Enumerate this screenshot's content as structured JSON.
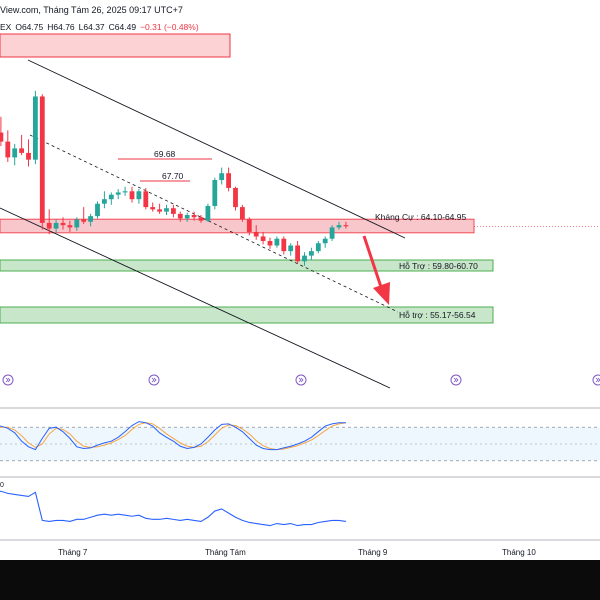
{
  "header": {
    "source": "View.com, Tháng Tám 26, 2025 09:17 UTC+7",
    "symbol_suffix": "EX",
    "open": "O64.75",
    "high": "H64.76",
    "low": "L64.37",
    "close": "C64.49",
    "change": "−0.31 (−0.48%)"
  },
  "levels": {
    "resistance": "Kháng Cự : 64.10-64.95",
    "support1": "Hỗ Trợ : 59.80-60.70",
    "support2": "Hỗ trợ : 55.17-56.54",
    "peak1": "69.68",
    "peak2": "67.70"
  },
  "stoch_label": "",
  "rsi_value": "0",
  "months": [
    "Tháng 7",
    "Tháng Tám",
    "Tháng 9",
    "Tháng 10"
  ],
  "colors": {
    "bull": "#26a69a",
    "bear": "#f23645",
    "resistance_fill": "#f8c2c6",
    "support_fill": "#c8e6c9",
    "line_blue": "#2962ff",
    "line_orange": "#f7a541"
  },
  "chart_data": {
    "type": "candlestick",
    "candles": [
      [
        70.5,
        73.5,
        69.8,
        72.8
      ],
      [
        72.8,
        74.2,
        71.6,
        72.0
      ],
      [
        72.0,
        73.0,
        70.2,
        70.6
      ],
      [
        70.6,
        71.8,
        69.9,
        71.4
      ],
      [
        71.4,
        72.6,
        70.8,
        71.0
      ],
      [
        71.0,
        72.2,
        69.8,
        70.4
      ],
      [
        70.4,
        76.5,
        70.0,
        76.0
      ],
      [
        76.0,
        76.2,
        64.2,
        64.8
      ],
      [
        64.8,
        66.0,
        63.8,
        64.3
      ],
      [
        64.3,
        65.1,
        63.9,
        64.8
      ],
      [
        64.8,
        65.3,
        64.2,
        64.6
      ],
      [
        64.6,
        65.0,
        64.0,
        64.4
      ],
      [
        64.4,
        65.3,
        64.1,
        65.1
      ],
      [
        65.1,
        66.2,
        64.7,
        64.9
      ],
      [
        64.9,
        65.6,
        64.5,
        65.4
      ],
      [
        65.4,
        66.7,
        65.2,
        66.5
      ],
      [
        66.5,
        67.6,
        66.1,
        66.9
      ],
      [
        66.9,
        67.5,
        66.4,
        67.3
      ],
      [
        67.3,
        67.8,
        66.9,
        67.5
      ],
      [
        67.5,
        68.0,
        67.2,
        67.6
      ],
      [
        67.6,
        68.0,
        66.6,
        66.9
      ],
      [
        66.9,
        67.8,
        66.5,
        67.6
      ],
      [
        67.6,
        67.9,
        66.0,
        66.2
      ],
      [
        66.2,
        66.6,
        65.8,
        66.0
      ],
      [
        66.0,
        66.5,
        65.6,
        65.8
      ],
      [
        65.8,
        66.4,
        65.5,
        66.1
      ],
      [
        66.1,
        66.4,
        65.3,
        65.6
      ],
      [
        65.6,
        65.8,
        64.9,
        65.2
      ],
      [
        65.2,
        65.7,
        64.9,
        65.5
      ],
      [
        65.5,
        65.8,
        65.0,
        65.3
      ],
      [
        65.3,
        65.5,
        64.8,
        65.0
      ],
      [
        65.0,
        66.5,
        64.9,
        66.3
      ],
      [
        66.3,
        68.8,
        66.0,
        68.6
      ],
      [
        68.6,
        69.7,
        68.2,
        69.2
      ],
      [
        69.2,
        69.7,
        67.6,
        67.9
      ],
      [
        67.9,
        68.0,
        65.9,
        66.2
      ],
      [
        66.2,
        66.4,
        64.9,
        65.1
      ],
      [
        65.1,
        65.3,
        63.7,
        64.0
      ],
      [
        64.0,
        64.6,
        63.3,
        63.6
      ],
      [
        63.6,
        64.0,
        62.9,
        63.2
      ],
      [
        63.2,
        63.5,
        62.5,
        62.8
      ],
      [
        62.8,
        63.6,
        62.6,
        63.4
      ],
      [
        63.4,
        63.6,
        62.0,
        62.3
      ],
      [
        62.3,
        63.0,
        61.9,
        62.8
      ],
      [
        62.8,
        63.2,
        61.2,
        61.4
      ],
      [
        61.4,
        62.2,
        61.0,
        61.9
      ],
      [
        61.9,
        62.6,
        61.5,
        62.3
      ],
      [
        62.3,
        63.2,
        62.1,
        63.0
      ],
      [
        63.0,
        63.6,
        62.6,
        63.4
      ],
      [
        63.4,
        64.6,
        63.2,
        64.4
      ],
      [
        64.4,
        64.9,
        64.2,
        64.6
      ],
      [
        64.6,
        64.9,
        64.3,
        64.5
      ]
    ],
    "resistance_zone": [
      64.1,
      64.95
    ],
    "support_zones": [
      [
        59.8,
        60.7
      ],
      [
        55.17,
        56.54
      ]
    ],
    "ylim": [
      50,
      81
    ],
    "months": [
      "Tháng 7",
      "Tháng Tám",
      "Tháng 9",
      "Tháng 10"
    ],
    "stochastic": {
      "k": [
        80,
        82,
        78,
        70,
        55,
        45,
        40,
        60,
        78,
        80,
        72,
        60,
        45,
        42,
        43,
        48,
        52,
        55,
        62,
        72,
        83,
        90,
        88,
        82,
        70,
        62,
        55,
        46,
        42,
        44,
        50,
        62,
        75,
        85,
        86,
        80,
        72,
        60,
        48,
        42,
        40,
        40,
        43,
        46,
        50,
        55,
        62,
        72,
        82,
        86,
        88,
        88
      ],
      "d": [
        78,
        80,
        80,
        75,
        65,
        52,
        44,
        50,
        68,
        78,
        76,
        68,
        55,
        46,
        44,
        45,
        48,
        52,
        58,
        65,
        76,
        85,
        88,
        86,
        78,
        68,
        60,
        52,
        46,
        44,
        46,
        54,
        66,
        78,
        84,
        83,
        77,
        68,
        56,
        47,
        42,
        40,
        41,
        44,
        47,
        52,
        57,
        65,
        74,
        82,
        86,
        88
      ]
    },
    "rsi": [
      62,
      63,
      61,
      60,
      59,
      58,
      62,
      35,
      34,
      35,
      35,
      34,
      36,
      36,
      38,
      40,
      41,
      40,
      41,
      40,
      39,
      40,
      37,
      36,
      36,
      37,
      36,
      35,
      36,
      35,
      34,
      38,
      44,
      46,
      42,
      38,
      35,
      33,
      32,
      31,
      30,
      32,
      31,
      32,
      30,
      31,
      31,
      33,
      34,
      35,
      35,
      34
    ]
  }
}
